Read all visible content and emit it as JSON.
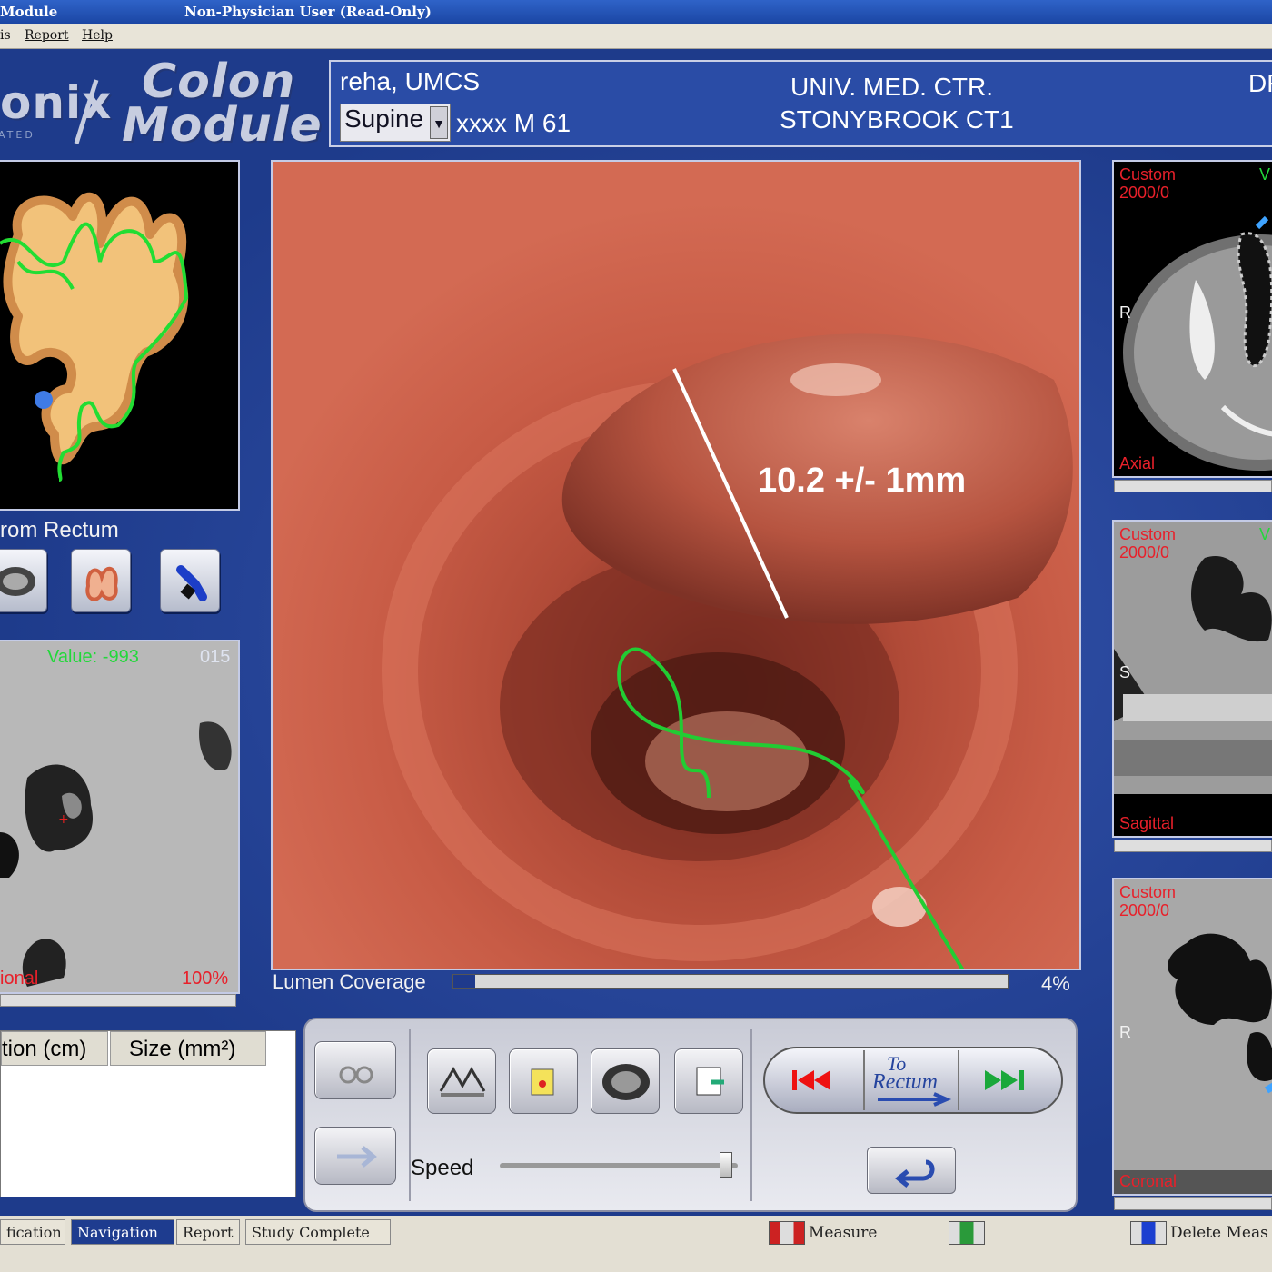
{
  "titlebar": {
    "app_title": "Module",
    "user_mode": "Non-Physician User (Read-Only)"
  },
  "menubar": {
    "items": [
      "is",
      "Report",
      "Help"
    ]
  },
  "logo": {
    "brand_fragment": "onix",
    "sub_fragment": "ATED",
    "module_line1": "Colon",
    "module_line2": "Module"
  },
  "patient": {
    "name": "reha, UMCS",
    "position": "Supine",
    "demographics": "xxxx M 61",
    "institution_line1": "UNIV. MED. CTR.",
    "institution_line2": "STONYBROOK CT1",
    "right_fragment": "DF"
  },
  "overview": {
    "label": "rom Rectum"
  },
  "overview_buttons": [
    "axial-slice-icon",
    "colon-map-icon",
    "endoscope-icon"
  ],
  "mpr_small": {
    "value_label": "Value: -993",
    "slice": "015",
    "plane": "ional",
    "zoom": "100%"
  },
  "endoview": {
    "measurement": "10.2 +/- 1mm",
    "lumen_label": "Lumen Coverage",
    "lumen_percent": "4%",
    "lumen_fraction": 0.04,
    "colors": {
      "wall": "#c65a45",
      "centerline": "#22cc33"
    }
  },
  "right_views": [
    {
      "window_name": "Custom",
      "window_values": "2000/0",
      "orientation": "R",
      "plane": "Axial",
      "corner": "V"
    },
    {
      "window_name": "Custom",
      "window_values": "2000/0",
      "orientation": "S",
      "plane": "Sagittal",
      "corner": "V"
    },
    {
      "window_name": "Custom",
      "window_values": "2000/0",
      "orientation": "R",
      "plane": "Coronal",
      "corner": ""
    }
  ],
  "findings_table": {
    "columns": [
      "tion (cm)",
      "Size (mm²)"
    ],
    "rows": []
  },
  "controls": {
    "speed_label": "Speed",
    "speed_value": 0.95,
    "to_rectum_line1": "To",
    "to_rectum_line2": "Rectum"
  },
  "tabs": [
    "fication",
    "Navigation",
    "Report",
    "Study Complete"
  ],
  "active_tab": "Navigation",
  "status": {
    "measure_label": "Measure",
    "delete_label": "Delete Meas"
  }
}
